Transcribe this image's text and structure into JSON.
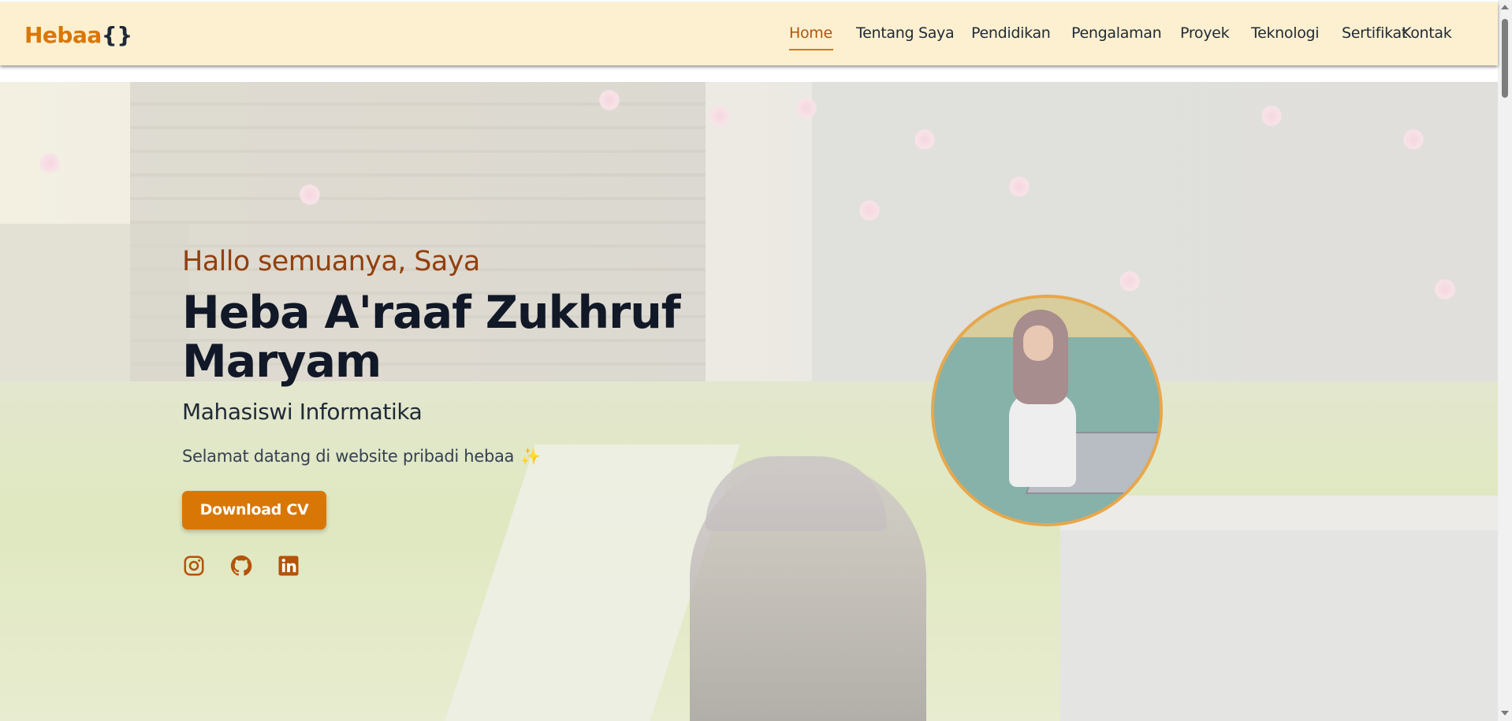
{
  "navbar": {
    "logo_text": "Hebaa",
    "logo_braces": "{}",
    "links": [
      "Home",
      "Tentang Saya",
      "Pendidikan",
      "Pengalaman",
      "Proyek",
      "Teknologi",
      "Sertifikat",
      "Kontak"
    ],
    "active_link": "Home"
  },
  "hero": {
    "greeting": "Hallo semuanya, Saya",
    "name": "Heba A'raaf Zukhruf Maryam",
    "role": "Mahasiswi Informatika",
    "welcome": "Selamat datang di website pribadi hebaa",
    "welcome_emoji": "✨",
    "cv_button": "Download CV",
    "social_icons": [
      "instagram-icon",
      "github-icon",
      "linkedin-icon"
    ]
  },
  "colors": {
    "accent": "#d97706",
    "greeting": "#92400e",
    "navbar_bg": "#fdf0d0",
    "photo_border": "#e8a74a"
  }
}
